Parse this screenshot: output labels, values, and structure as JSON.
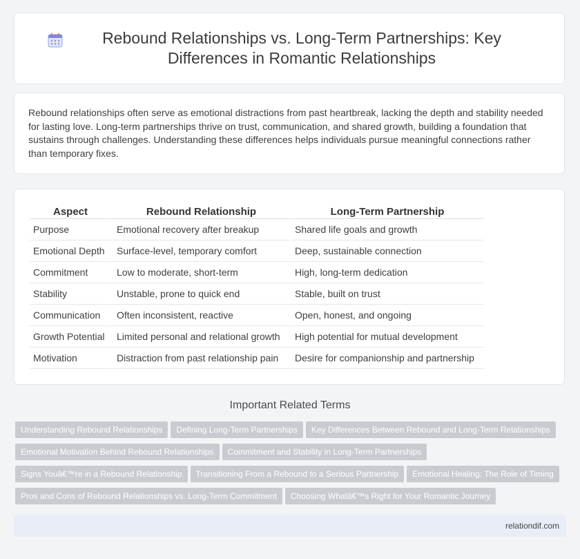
{
  "header": {
    "icon": "calendar-icon",
    "title": "Rebound Relationships vs. Long-Term Partnerships: Key Differences in Romantic Relationships"
  },
  "intro": "Rebound relationships often serve as emotional distractions from past heartbreak, lacking the depth and stability needed for lasting love. Long-term partnerships thrive on trust, communication, and shared growth, building a foundation that sustains through challenges. Understanding these differences helps individuals pursue meaningful connections rather than temporary fixes.",
  "table": {
    "headers": [
      "Aspect",
      "Rebound Relationship",
      "Long-Term Partnership"
    ],
    "rows": [
      [
        "Purpose",
        "Emotional recovery after breakup",
        "Shared life goals and growth"
      ],
      [
        "Emotional Depth",
        "Surface-level, temporary comfort",
        "Deep, sustainable connection"
      ],
      [
        "Commitment",
        "Low to moderate, short-term",
        "High, long-term dedication"
      ],
      [
        "Stability",
        "Unstable, prone to quick end",
        "Stable, built on trust"
      ],
      [
        "Communication",
        "Often inconsistent, reactive",
        "Open, honest, and ongoing"
      ],
      [
        "Growth Potential",
        "Limited personal and relational growth",
        "High potential for mutual development"
      ],
      [
        "Motivation",
        "Distraction from past relationship pain",
        "Desire for companionship and partnership"
      ]
    ]
  },
  "related": {
    "title": "Important Related Terms",
    "tags": [
      "Understanding Rebound Relationships",
      "Defining Long-Term Partnerships",
      "Key Differences Between Rebound and Long-Term Relationships",
      "Emotional Motivation Behind Rebound Relationships",
      "Commitment and Stability in Long-Term Partnerships",
      "Signs Youâ€™re in a Rebound Relationship",
      "Transitioning From a Rebound to a Serious Partnership",
      "Emotional Healing: The Role of Timing",
      "Pros and Cons of Rebound Relationships vs. Long-Term Commitment",
      "Choosing Whatâ€™s Right for Your Romantic Journey"
    ]
  },
  "footer": {
    "site": "relationdif.com"
  }
}
